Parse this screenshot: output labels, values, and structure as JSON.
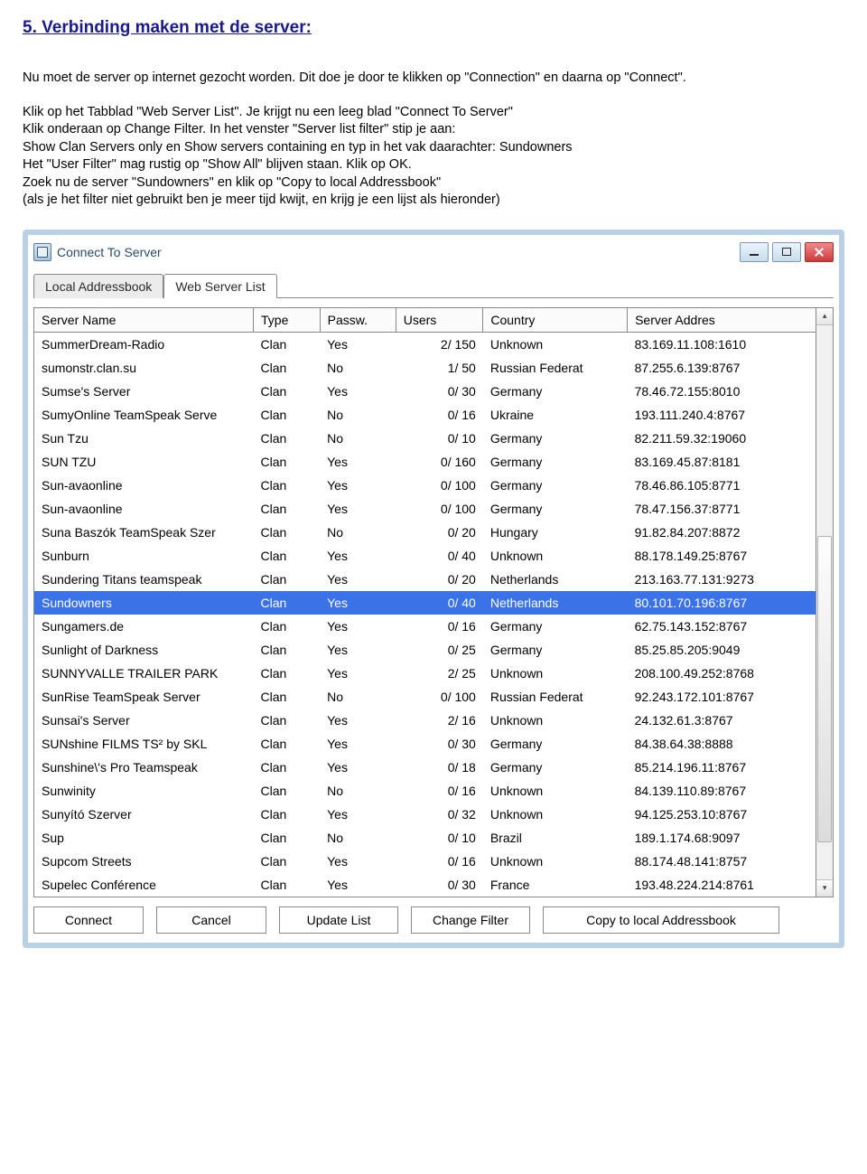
{
  "heading": "5. Verbinding maken met de server:",
  "paragraphs": {
    "p1_a": "Nu moet de server op internet gezocht worden. ",
    "p1_b": "Dit doe je door te klikken op \"Connection\" en daarna op \"Connect\".",
    "p2": "Klik op het Tabblad \"Web Server List\". Je krijgt nu een leeg blad \"Connect To Server\"",
    "p3_a": "Klik onderaan op Change Filter. ",
    "p3_b": "In het venster \"Server list filter\" stip je aan:",
    "p4": "Show Clan Servers only  en  Show servers containing  en typ in het vak daarachter:  Sundowners",
    "p5": "Het \"User Filter\" mag rustig op \"Show All\" blijven staan.  Klik op OK.",
    "p6": "Zoek nu de server \"Sundowners\" en klik op \"Copy to local Addressbook\"",
    "p7": "(als je het filter niet gebruikt ben je meer tijd kwijt, en krijg je een lijst als hieronder)"
  },
  "window_title": "Connect To Server",
  "tabs": [
    {
      "label": "Local Addressbook",
      "active": false
    },
    {
      "label": "Web Server List",
      "active": true
    }
  ],
  "columns": [
    "Server Name",
    "Type",
    "Passw.",
    "Users",
    "Country",
    "Server Addres"
  ],
  "rows": [
    {
      "name": "SummerDream-Radio",
      "type": "Clan",
      "pass": "Yes",
      "users": "2/ 150",
      "country": "Unknown",
      "addr": "83.169.11.108:1610",
      "selected": false
    },
    {
      "name": "sumonstr.clan.su",
      "type": "Clan",
      "pass": "No",
      "users": "1/  50",
      "country": "Russian Federat",
      "addr": "87.255.6.139:8767",
      "selected": false
    },
    {
      "name": "Sumse's Server",
      "type": "Clan",
      "pass": "Yes",
      "users": "0/  30",
      "country": "Germany",
      "addr": "78.46.72.155:8010",
      "selected": false
    },
    {
      "name": "SumyOnline TeamSpeak Serve",
      "type": "Clan",
      "pass": "No",
      "users": "0/  16",
      "country": "Ukraine",
      "addr": "193.111.240.4:8767",
      "selected": false
    },
    {
      "name": "Sun Tzu",
      "type": "Clan",
      "pass": "No",
      "users": "0/  10",
      "country": "Germany",
      "addr": "82.211.59.32:19060",
      "selected": false
    },
    {
      "name": "SUN TZU",
      "type": "Clan",
      "pass": "Yes",
      "users": "0/ 160",
      "country": "Germany",
      "addr": "83.169.45.87:8181",
      "selected": false
    },
    {
      "name": "Sun-avaonline",
      "type": "Clan",
      "pass": "Yes",
      "users": "0/ 100",
      "country": "Germany",
      "addr": "78.46.86.105:8771",
      "selected": false
    },
    {
      "name": "Sun-avaonline",
      "type": "Clan",
      "pass": "Yes",
      "users": "0/ 100",
      "country": "Germany",
      "addr": "78.47.156.37:8771",
      "selected": false
    },
    {
      "name": "Suna Baszók TeamSpeak Szer",
      "type": "Clan",
      "pass": "No",
      "users": "0/  20",
      "country": "Hungary",
      "addr": "91.82.84.207:8872",
      "selected": false
    },
    {
      "name": "Sunburn",
      "type": "Clan",
      "pass": "Yes",
      "users": "0/  40",
      "country": "Unknown",
      "addr": "88.178.149.25:8767",
      "selected": false
    },
    {
      "name": "Sundering Titans teamspeak",
      "type": "Clan",
      "pass": "Yes",
      "users": "0/  20",
      "country": "Netherlands",
      "addr": "213.163.77.131:9273",
      "selected": false
    },
    {
      "name": "Sundowners",
      "type": "Clan",
      "pass": "Yes",
      "users": "0/  40",
      "country": "Netherlands",
      "addr": "80.101.70.196:8767",
      "selected": true
    },
    {
      "name": "Sungamers.de",
      "type": "Clan",
      "pass": "Yes",
      "users": "0/  16",
      "country": "Germany",
      "addr": "62.75.143.152:8767",
      "selected": false
    },
    {
      "name": "Sunlight of Darkness",
      "type": "Clan",
      "pass": "Yes",
      "users": "0/  25",
      "country": "Germany",
      "addr": "85.25.85.205:9049",
      "selected": false
    },
    {
      "name": "SUNNYVALLE TRAILER PARK",
      "type": "Clan",
      "pass": "Yes",
      "users": "2/  25",
      "country": "Unknown",
      "addr": "208.100.49.252:8768",
      "selected": false
    },
    {
      "name": "SunRise TeamSpeak Server",
      "type": "Clan",
      "pass": "No",
      "users": "0/ 100",
      "country": "Russian Federat",
      "addr": "92.243.172.101:8767",
      "selected": false
    },
    {
      "name": "Sunsai's Server",
      "type": "Clan",
      "pass": "Yes",
      "users": "2/  16",
      "country": "Unknown",
      "addr": "24.132.61.3:8767",
      "selected": false
    },
    {
      "name": "SUNshine FILMS TS² by SKL",
      "type": "Clan",
      "pass": "Yes",
      "users": "0/  30",
      "country": "Germany",
      "addr": "84.38.64.38:8888",
      "selected": false
    },
    {
      "name": "Sunshine\\'s Pro Teamspeak",
      "type": "Clan",
      "pass": "Yes",
      "users": "0/  18",
      "country": "Germany",
      "addr": "85.214.196.11:8767",
      "selected": false
    },
    {
      "name": "Sunwinity",
      "type": "Clan",
      "pass": "No",
      "users": "0/  16",
      "country": "Unknown",
      "addr": "84.139.110.89:8767",
      "selected": false
    },
    {
      "name": "Sunyító Szerver",
      "type": "Clan",
      "pass": "Yes",
      "users": "0/  32",
      "country": "Unknown",
      "addr": "94.125.253.10:8767",
      "selected": false
    },
    {
      "name": "Sup",
      "type": "Clan",
      "pass": "No",
      "users": "0/  10",
      "country": "Brazil",
      "addr": "189.1.174.68:9097",
      "selected": false
    },
    {
      "name": "Supcom Streets",
      "type": "Clan",
      "pass": "Yes",
      "users": "0/  16",
      "country": "Unknown",
      "addr": "88.174.48.141:8757",
      "selected": false
    },
    {
      "name": "Supelec Conférence",
      "type": "Clan",
      "pass": "Yes",
      "users": "0/  30",
      "country": "France",
      "addr": "193.48.224.214:8761",
      "selected": false
    }
  ],
  "buttons": {
    "connect": "Connect",
    "cancel": "Cancel",
    "update": "Update List",
    "filter": "Change Filter",
    "copy": "Copy to local Addressbook"
  }
}
